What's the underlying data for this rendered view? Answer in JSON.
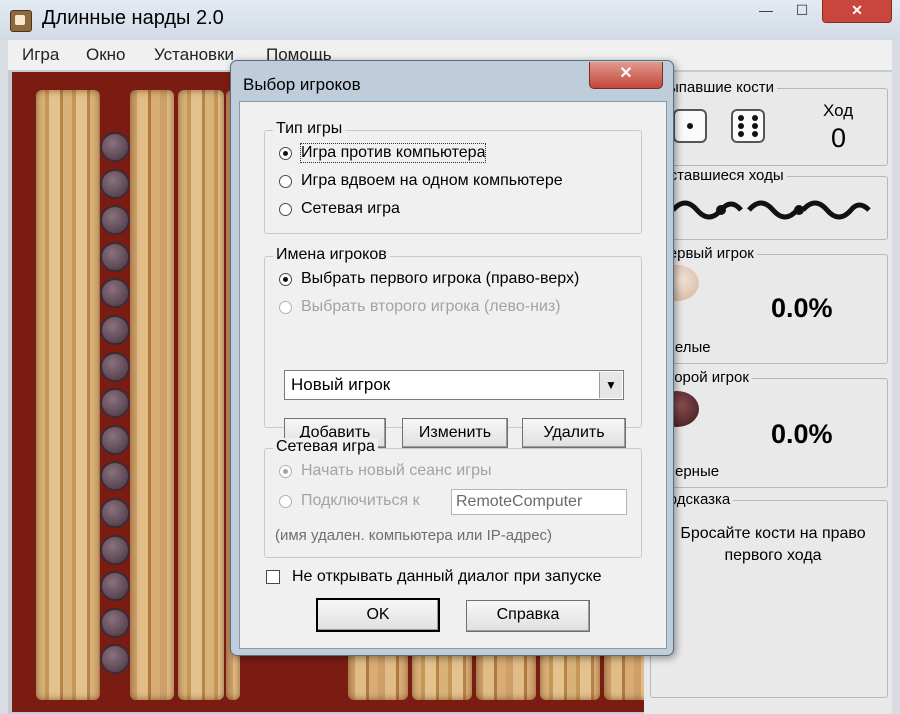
{
  "window": {
    "title": "Длинные нарды 2.0",
    "minimize": "—",
    "maximize": "☐",
    "close": "✕"
  },
  "menu": [
    "Игра",
    "Окно",
    "Установки",
    "Помощь"
  ],
  "side_panel": {
    "dice_label": "Выпавшие кости",
    "turn_label": "Ход",
    "turn_value": "0",
    "moves_label": "Оставшиеся ходы",
    "first_player_label": "Первый игрок",
    "first_player_pct": "0.0%",
    "first_player_color": "Белые",
    "second_player_label": "Второй игрок",
    "second_player_pct": "0.0%",
    "second_player_color": "Черные",
    "hint_label": "Подсказка",
    "hint_text": "Бросайте кости на право первого хода"
  },
  "dialog": {
    "title": "Выбор игроков",
    "close": "✕",
    "game_type": {
      "label": "Тип игры",
      "options": [
        "Игра против компьютера",
        "Игра вдвоем на одном компьютере",
        "Сетевая игра"
      ],
      "selected": 0
    },
    "player_names": {
      "label": "Имена игроков",
      "option_first": "Выбрать первого игрока (право-верх)",
      "option_second": "Выбрать второго игрока (лево-низ)",
      "player_select_value": "Новый игрок",
      "add_button": "Добавить",
      "edit_button": "Изменить",
      "delete_button": "Удалить"
    },
    "network": {
      "label": "Сетевая игра",
      "option_new": "Начать новый сеанс игры",
      "option_connect": "Подключиться к",
      "host_value": "RemoteComputer",
      "hint": "(имя удален. компьютера или IP-адрес)"
    },
    "no_show_checkbox": "Не открывать данный диалог при запуске",
    "ok_button": "OK",
    "help_button": "Справка"
  }
}
